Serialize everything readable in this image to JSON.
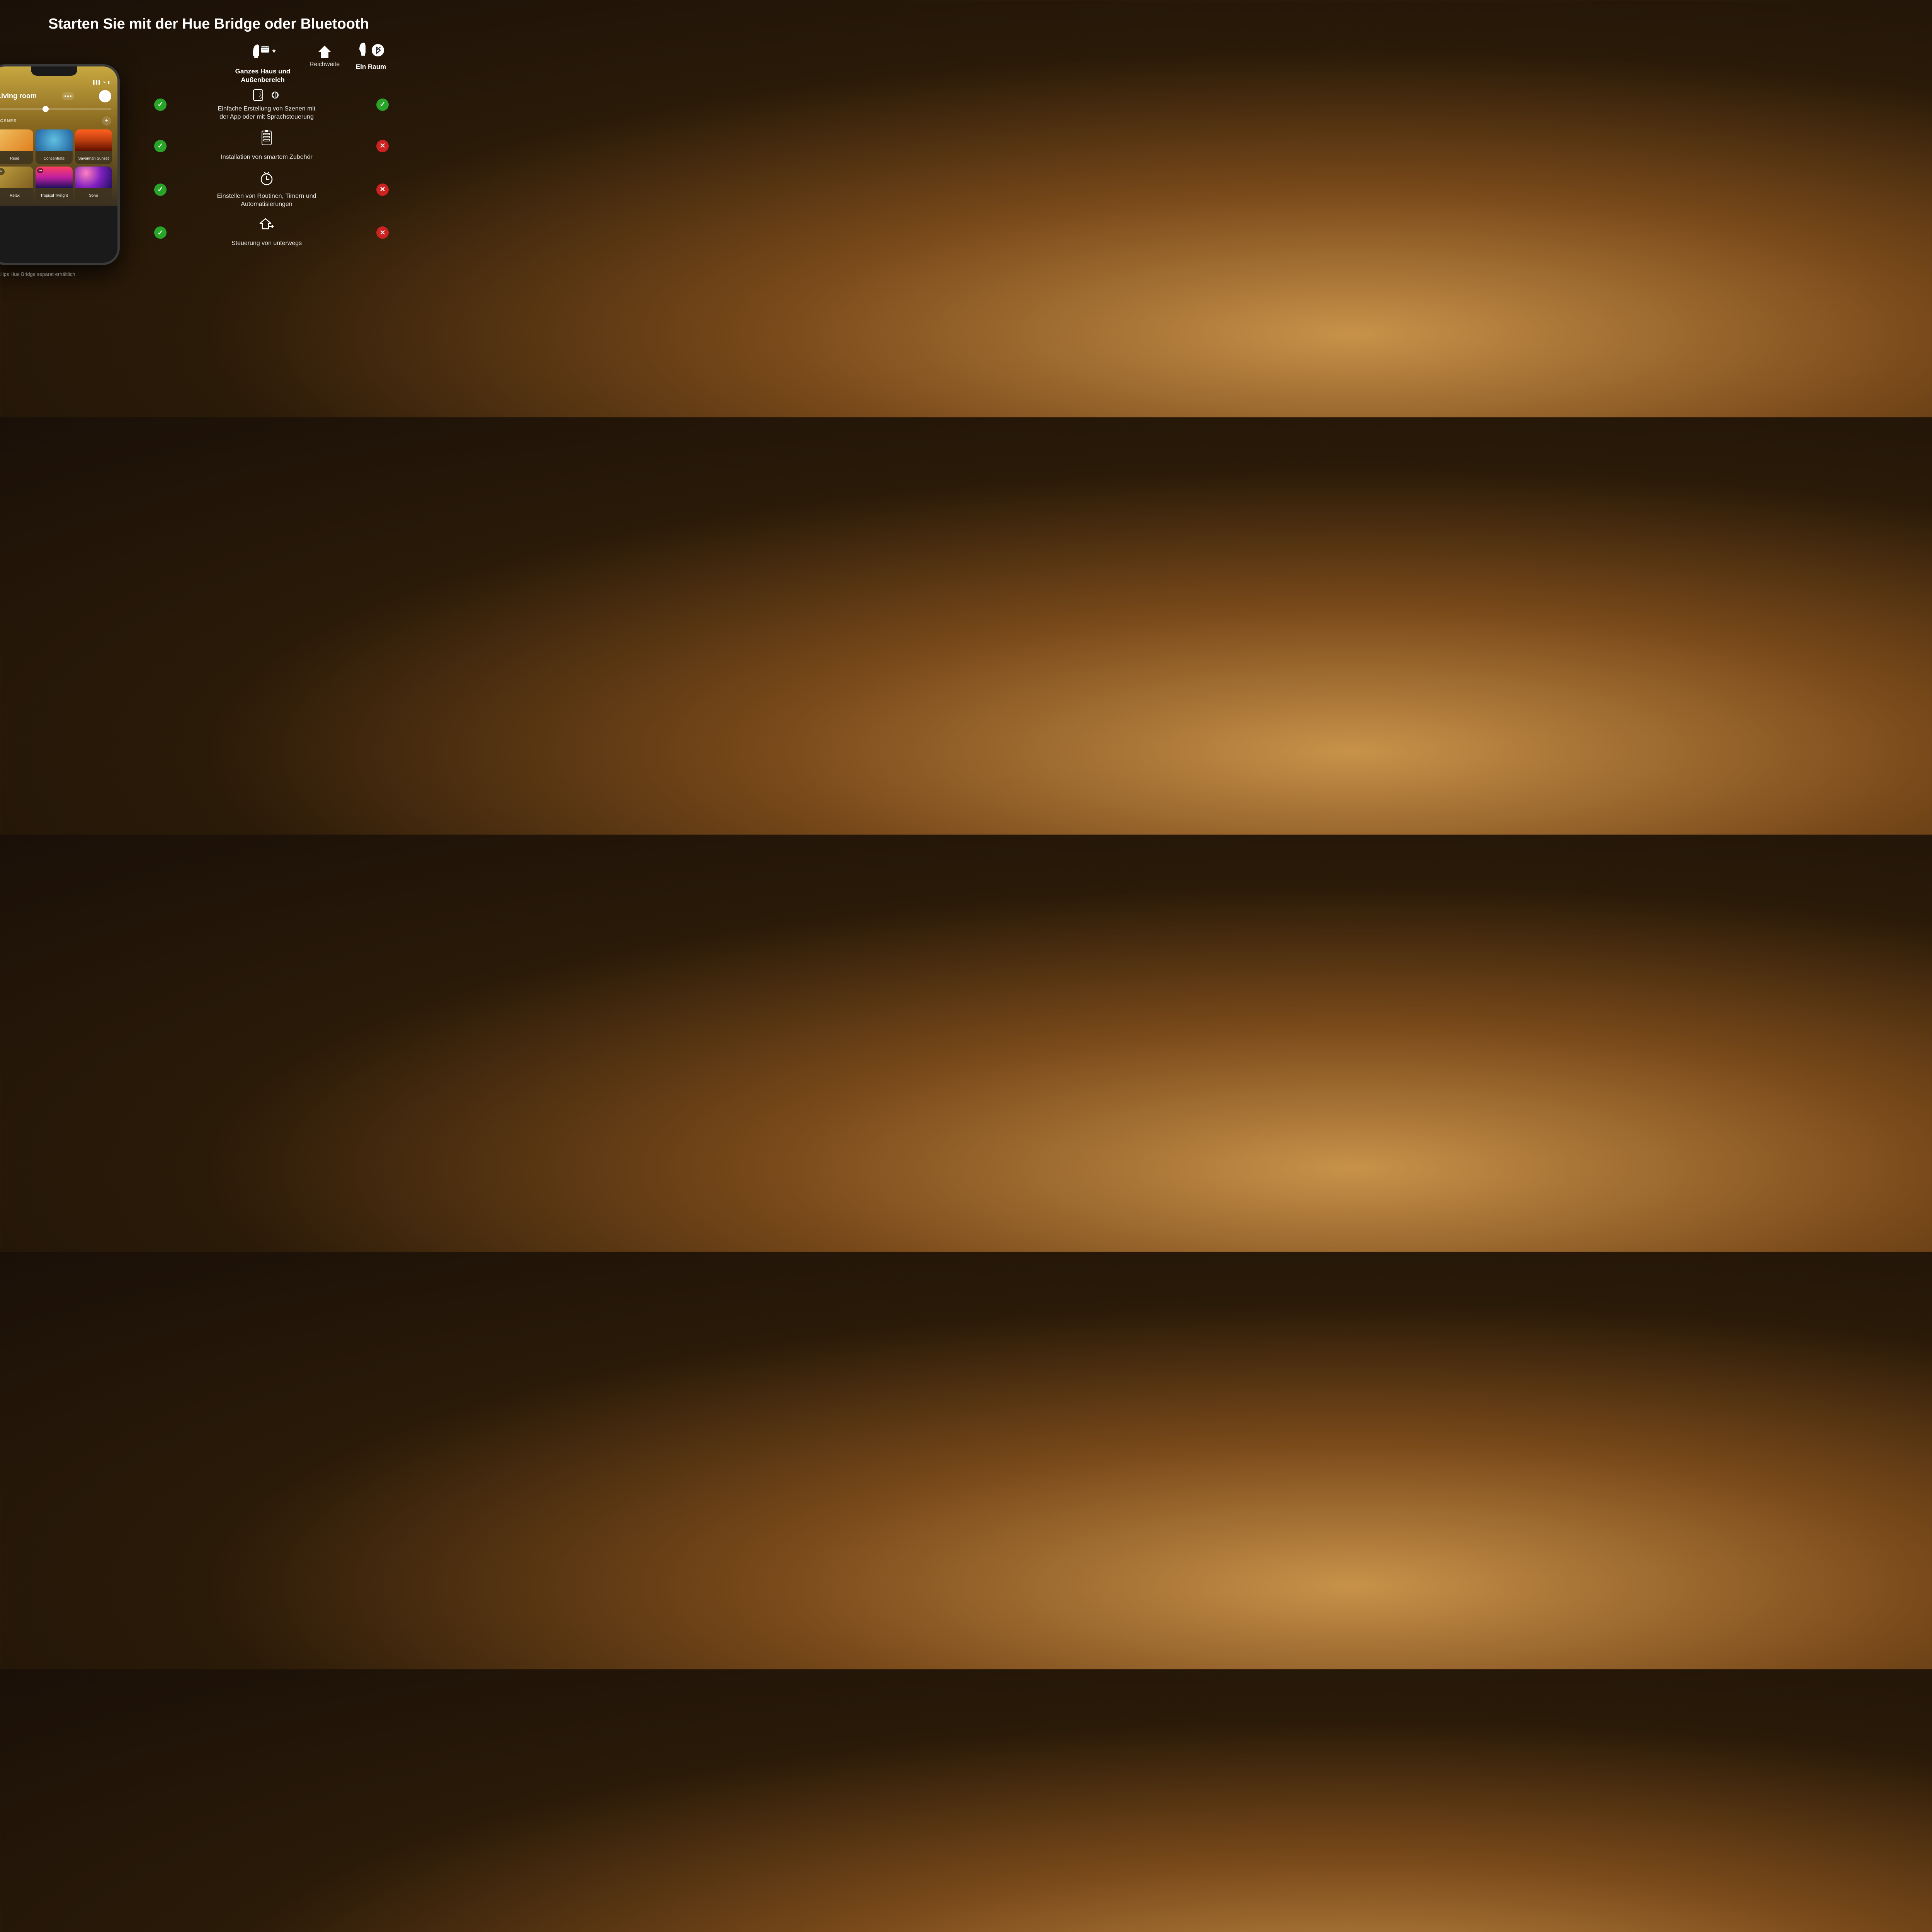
{
  "header": {
    "title": "Starten Sie mit der Hue Bridge oder Bluetooth"
  },
  "left_col": {
    "icons_label": "Ganzes Haus und Außenbereich",
    "asterisk": "*"
  },
  "center_col": {
    "label": "Reichweite"
  },
  "right_col": {
    "label": "Ein Raum"
  },
  "phone_note": "*Philips Hue Bridge separat erhältlich",
  "phone": {
    "room": "Living room",
    "scenes_label": "SCENES",
    "scenes": [
      {
        "name": "Read",
        "type": "read"
      },
      {
        "name": "Concentrate",
        "type": "concentrate"
      },
      {
        "name": "Savannah Sunset",
        "type": "savannah"
      },
      {
        "name": "Relax",
        "type": "relax"
      },
      {
        "name": "Tropical Twilight",
        "type": "tropical"
      },
      {
        "name": "Soho",
        "type": "soho"
      }
    ]
  },
  "features": [
    {
      "icon_type": "nfc",
      "text": "Einfache Erstellung von Szenen mit der App oder mit Sprachsteuerung",
      "left_check": true,
      "right_check": true
    },
    {
      "icon_type": "accessory",
      "text": "Installation von smartem Zubehör",
      "left_check": true,
      "right_check": false
    },
    {
      "icon_type": "timer",
      "text": "Einstellen von Routinen, Timern und Automatisierungen",
      "left_check": true,
      "right_check": false
    },
    {
      "icon_type": "remote",
      "text": "Steuerung von unterwegs",
      "left_check": true,
      "right_check": false
    }
  ],
  "colors": {
    "check_green": "#28a428",
    "cross_red": "#cc2222",
    "bg_dark": "#1a1008",
    "bg_warm": "#c8924a"
  }
}
